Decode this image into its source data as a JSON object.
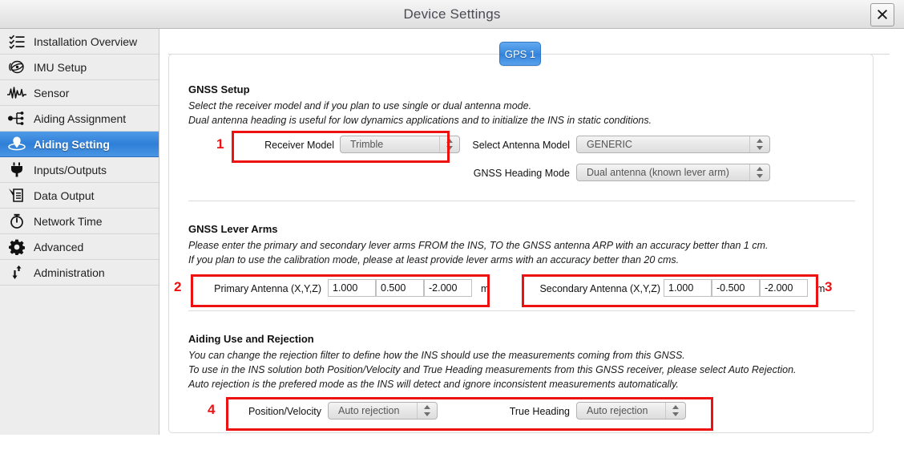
{
  "window": {
    "title": "Device Settings",
    "close_icon": "close-icon"
  },
  "sidebar": {
    "items": [
      {
        "label": "Installation Overview",
        "icon": "checklist-icon",
        "active": false
      },
      {
        "label": "IMU Setup",
        "icon": "imu-gyro-icon",
        "active": false
      },
      {
        "label": "Sensor",
        "icon": "waveform-icon",
        "active": false
      },
      {
        "label": "Aiding Assignment",
        "icon": "node-tree-icon",
        "active": false
      },
      {
        "label": "Aiding Setting",
        "icon": "location-pin-orbit-icon",
        "active": true
      },
      {
        "label": "Inputs/Outputs",
        "icon": "power-plug-icon",
        "active": false
      },
      {
        "label": "Data Output",
        "icon": "document-pen-icon",
        "active": false
      },
      {
        "label": "Network Time",
        "icon": "stopwatch-icon",
        "active": false
      },
      {
        "label": "Advanced",
        "icon": "gear-icon",
        "active": false
      },
      {
        "label": "Administration",
        "icon": "arrow-up-down-icon",
        "active": false
      }
    ]
  },
  "tabs": [
    {
      "label": "GPS 1",
      "active": true
    }
  ],
  "sections": {
    "gnss_setup": {
      "title": "GNSS Setup",
      "desc1": "Select the receiver model and if you plan to use single or dual antenna mode.",
      "desc2": "Dual antenna heading is useful for low dynamics applications and to initialize the INS in static conditions.",
      "receiver_model": {
        "label": "Receiver Model",
        "value": "Trimble"
      },
      "antenna_model": {
        "label": "Select Antenna Model",
        "value": "GENERIC"
      },
      "heading_mode": {
        "label": "GNSS Heading Mode",
        "value": "Dual antenna (known lever arm)"
      }
    },
    "lever_arms": {
      "title": "GNSS Lever Arms",
      "desc1": "Please enter the primary and secondary lever arms FROM the INS, TO the GNSS antenna ARP with an accuracy better than 1 cm.",
      "desc2": "If you plan to use the calibration mode, please at least provide lever arms with an accuracy better than 20 cms.",
      "primary": {
        "label": "Primary Antenna (X,Y,Z)",
        "x": "1.000",
        "y": "0.500",
        "z": "-2.000",
        "unit": "m"
      },
      "secondary": {
        "label": "Secondary Antenna (X,Y,Z)",
        "x": "1.000",
        "y": "-0.500",
        "z": "-2.000",
        "unit": "m"
      }
    },
    "aiding_rejection": {
      "title": "Aiding Use and Rejection",
      "desc1": "You can change the rejection filter to define how the INS should use the measurements coming from this GNSS.",
      "desc2": "To use in the INS solution both Position/Velocity and True Heading measurements from this GNSS receiver, please select Auto Rejection.",
      "desc3": "Auto rejection is the prefered mode as the INS will detect and ignore inconsistent measurements automatically.",
      "position_velocity": {
        "label": "Position/Velocity",
        "value": "Auto rejection"
      },
      "true_heading": {
        "label": "True Heading",
        "value": "Auto rejection"
      }
    }
  },
  "annotations": {
    "color": "#ee1111",
    "marks": [
      {
        "number": "1"
      },
      {
        "number": "2"
      },
      {
        "number": "3"
      },
      {
        "number": "4"
      }
    ]
  }
}
